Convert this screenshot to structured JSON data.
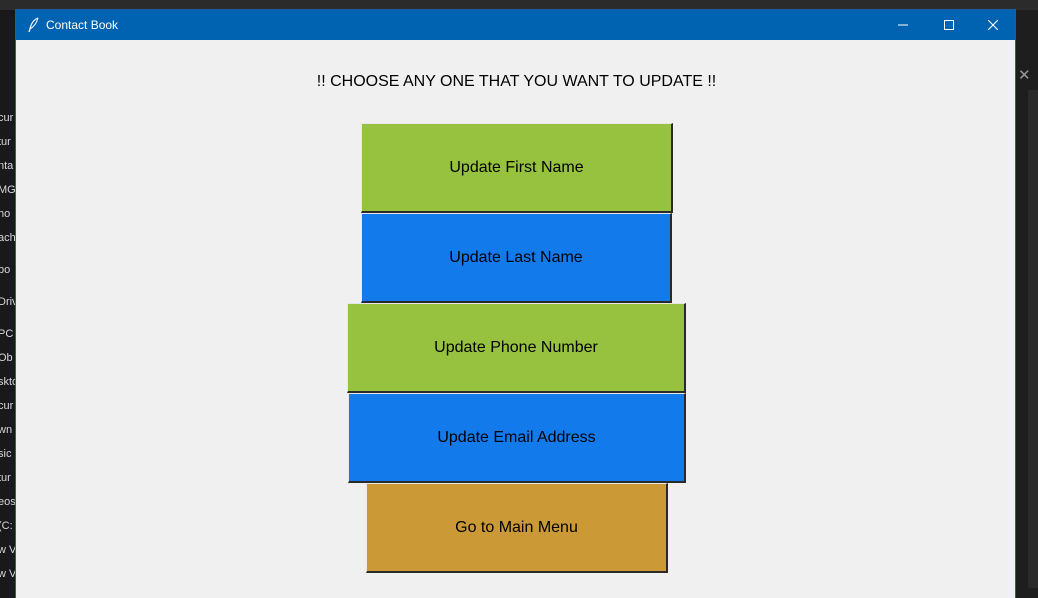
{
  "window": {
    "title": "Contact Book",
    "icon": "feather-icon",
    "controls": {
      "minimize": "minimize-icon",
      "maximize": "maximize-icon",
      "close": "close-icon"
    }
  },
  "main": {
    "heading": "!! CHOOSE ANY ONE THAT YOU WANT TO UPDATE !!",
    "buttons": [
      {
        "label": "Update First Name",
        "color": "#97c23f"
      },
      {
        "label": "Update Last Name",
        "color": "#127aeb"
      },
      {
        "label": "Update Phone Number",
        "color": "#97c23f"
      },
      {
        "label": "Update Email Address",
        "color": "#127aeb"
      },
      {
        "label": "Go to Main Menu",
        "color": "#cb9936"
      }
    ]
  },
  "background": {
    "explorer_items": [
      "cur",
      "tur",
      "nta",
      "MG",
      "ho",
      "ach",
      "bo",
      "Driv",
      "PC",
      "Ob",
      "skto",
      "cur",
      "wn",
      "sic",
      "tur",
      "eos",
      "(C:",
      "w V",
      "w V"
    ]
  }
}
